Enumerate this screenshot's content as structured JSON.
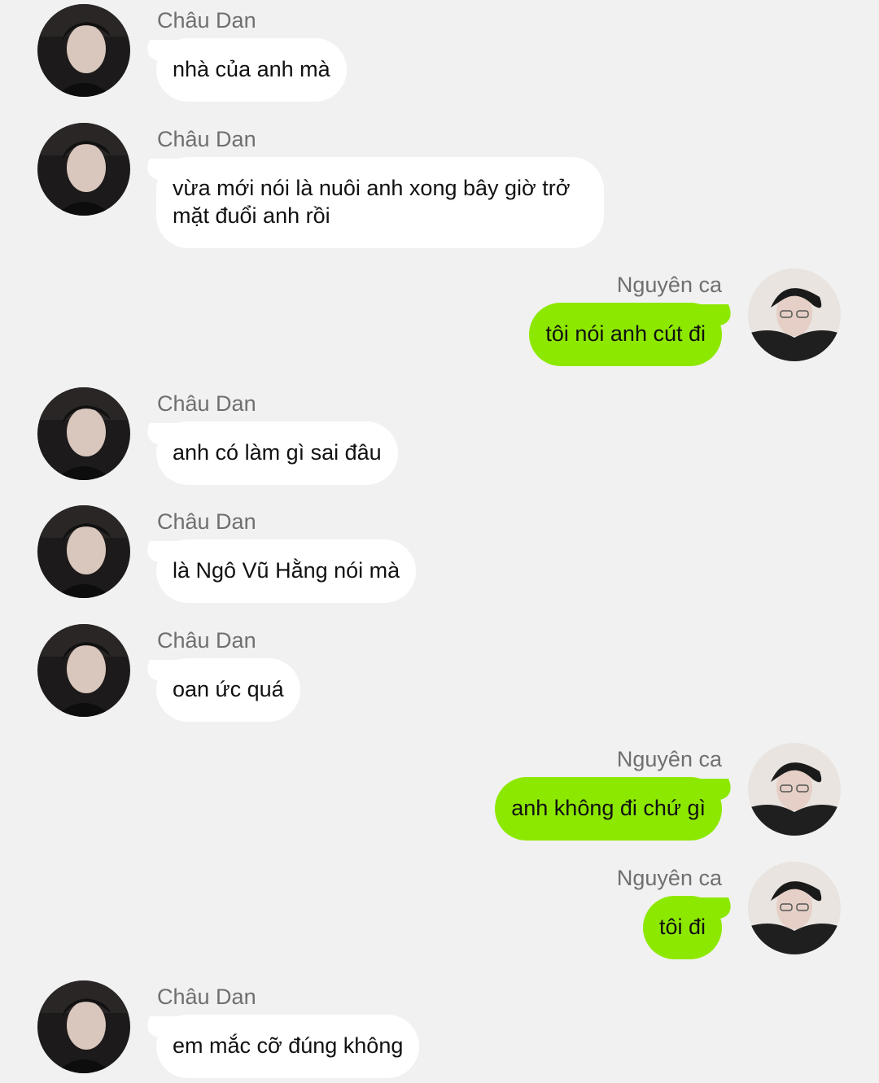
{
  "colors": {
    "background": "#f1f1f1",
    "incoming_bubble": "#ffffff",
    "outgoing_bubble": "#8de800",
    "sender_name": "#6f6f6f"
  },
  "messages": [
    {
      "sender": "Châu Dan",
      "text": "nhà của anh mà",
      "side": "left",
      "avatar": "chau-dan-avatar"
    },
    {
      "sender": "Châu Dan",
      "text": "vừa mới nói là nuôi anh xong bây giờ trở\nmặt đuổi anh rồi",
      "side": "left",
      "avatar": "chau-dan-avatar"
    },
    {
      "sender": "Nguyên ca",
      "text": "tôi nói anh cút đi",
      "side": "right",
      "avatar": "nguyen-ca-avatar"
    },
    {
      "sender": "Châu Dan",
      "text": "anh có làm gì sai đâu",
      "side": "left",
      "avatar": "chau-dan-avatar"
    },
    {
      "sender": "Châu Dan",
      "text": "là Ngô Vũ Hằng nói mà",
      "side": "left",
      "avatar": "chau-dan-avatar"
    },
    {
      "sender": "Châu Dan",
      "text": "oan ức quá",
      "side": "left",
      "avatar": "chau-dan-avatar"
    },
    {
      "sender": "Nguyên ca",
      "text": "anh không đi chứ gì",
      "side": "right",
      "avatar": "nguyen-ca-avatar"
    },
    {
      "sender": "Nguyên ca",
      "text": "tôi đi",
      "side": "right",
      "avatar": "nguyen-ca-avatar"
    },
    {
      "sender": "Châu Dan",
      "text": "em mắc cỡ đúng không",
      "side": "left",
      "avatar": "chau-dan-avatar"
    }
  ]
}
